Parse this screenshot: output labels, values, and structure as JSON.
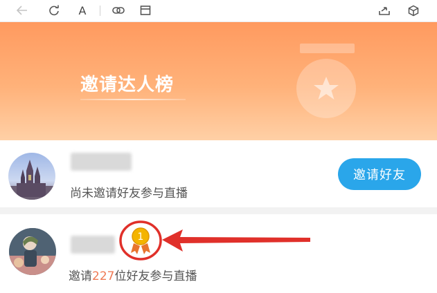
{
  "toolbar": {
    "icons": [
      "back-arrow-icon",
      "refresh-icon",
      "font-size-icon",
      "link-icon",
      "window-icon",
      "share-icon",
      "cube-icon"
    ],
    "font_label": "A"
  },
  "banner": {
    "title": "邀请达人榜",
    "colors": {
      "top": "#ff9a5f",
      "bottom": "#ffd0a6"
    }
  },
  "list": {
    "rows": [
      {
        "status_text": "尚未邀请好友参与直播",
        "action_label": "邀请好友"
      },
      {
        "rank_badge": "1",
        "status_prefix": "邀请",
        "invite_count": "227",
        "status_suffix": "位好友参与直播"
      }
    ]
  },
  "colors": {
    "button": "#2aa6ea",
    "count": "#ef7a55",
    "annotation": "#e0302a"
  }
}
